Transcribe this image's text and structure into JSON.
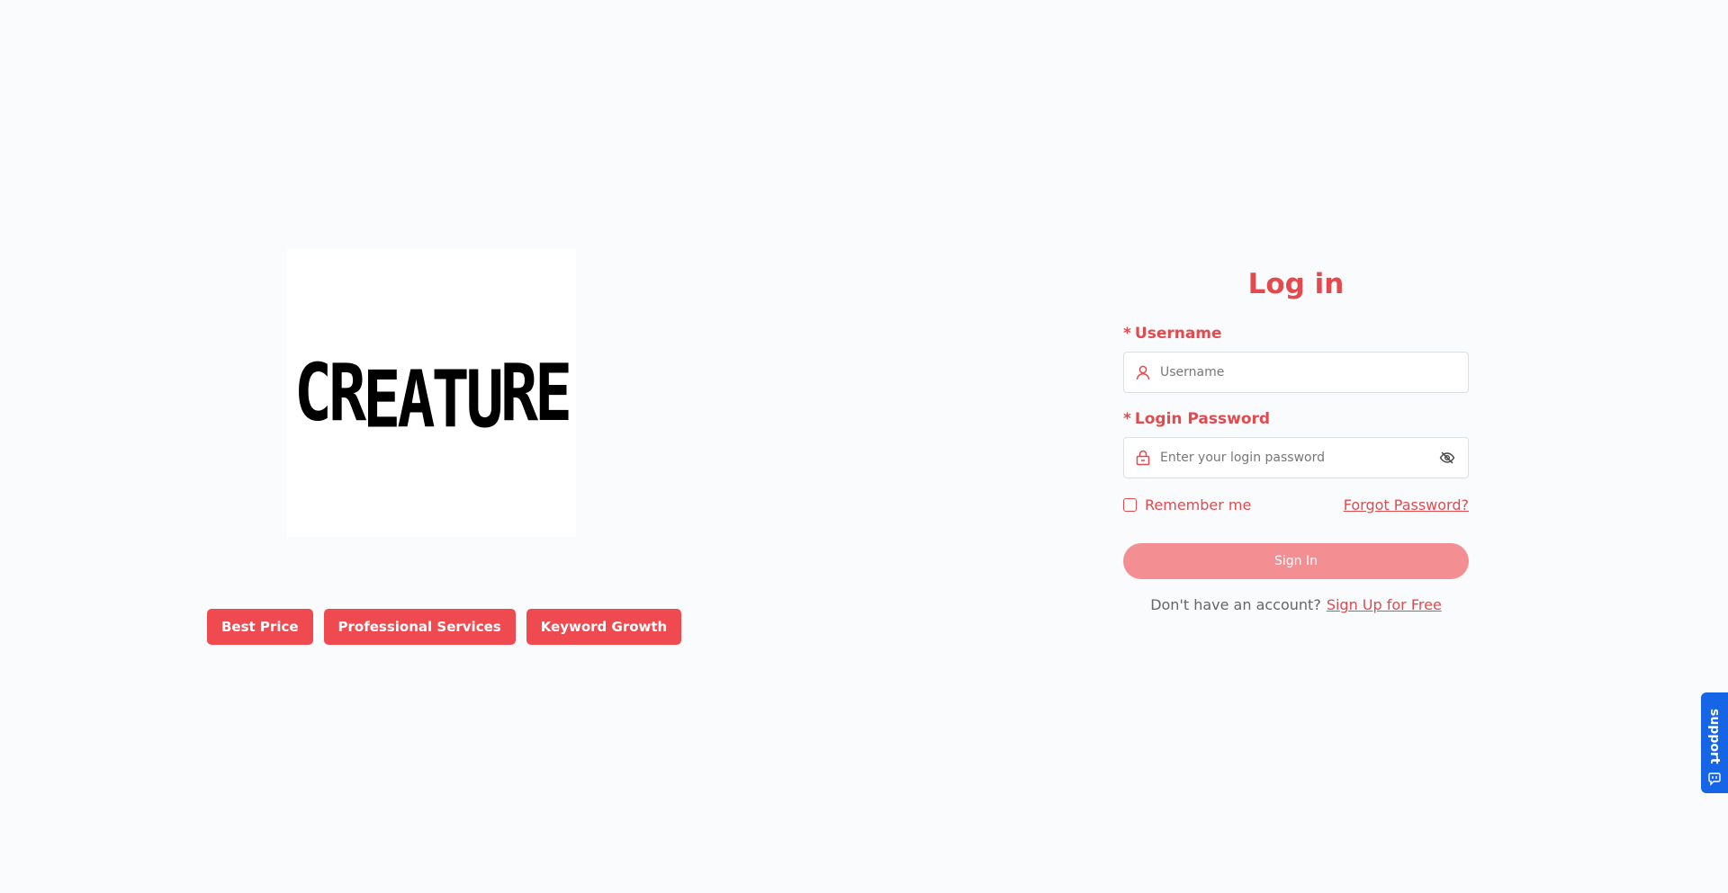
{
  "brand": {
    "logo_letters": [
      "C",
      "R",
      "E",
      "A",
      "T",
      "U",
      "R",
      "E"
    ],
    "logo_alt": "CREATURE"
  },
  "features": [
    {
      "label": "Best Price"
    },
    {
      "label": "Professional Services"
    },
    {
      "label": "Keyword Growth"
    }
  ],
  "login": {
    "title": "Log in",
    "required_mark": "*",
    "username_label": "Username",
    "username_placeholder": "Username",
    "username_value": "",
    "password_label": "Login Password",
    "password_placeholder": "Enter your login password",
    "password_value": "",
    "remember_label": "Remember me",
    "remember_checked": false,
    "forgot_label": "Forgot Password?",
    "signin_label": "Sign In",
    "signup_prompt": "Don't have an account?",
    "signup_link": "Sign Up for Free"
  },
  "support": {
    "label": "support"
  },
  "colors": {
    "brand_red": "#e24a4e",
    "tag_red": "#ef4a4f",
    "button_disabled": "#f38e92",
    "support_blue": "#1565e6",
    "background": "#fafbfc"
  },
  "icons": {
    "username": "user-icon",
    "password": "lock-icon",
    "toggle": "eye-off-icon",
    "support": "chat-icon"
  }
}
